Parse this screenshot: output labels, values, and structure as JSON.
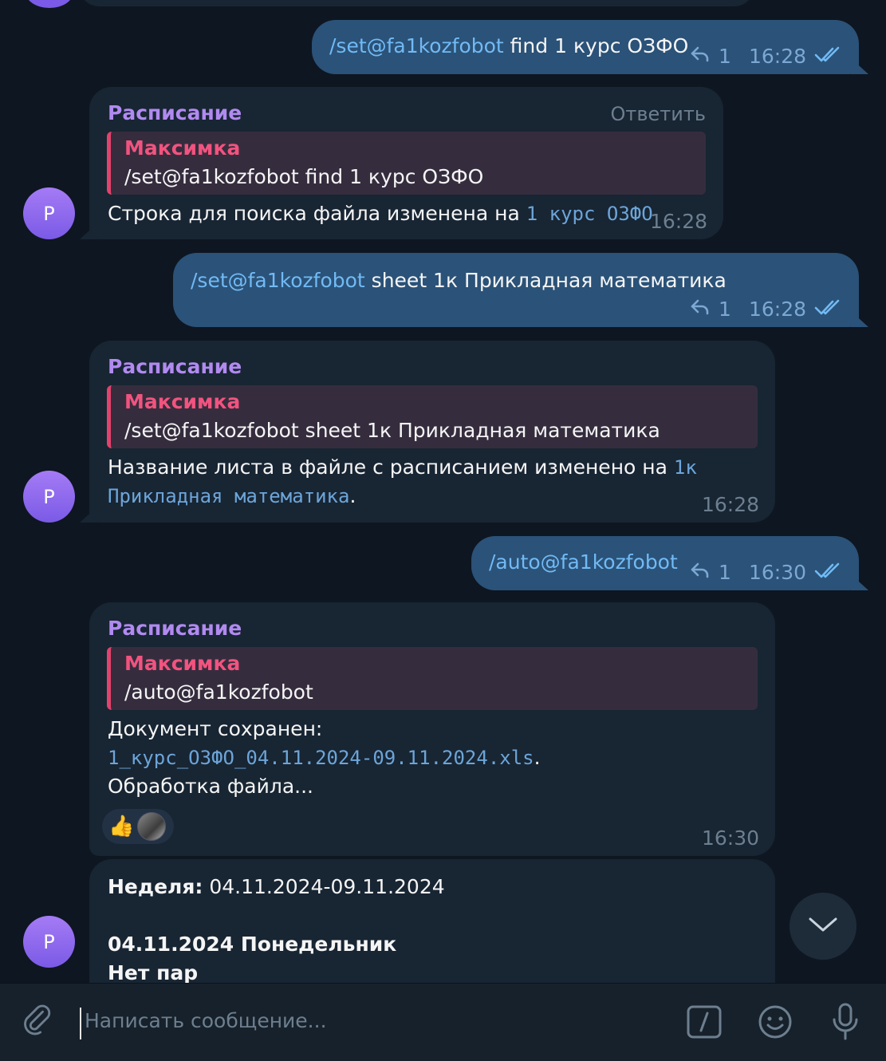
{
  "messages": {
    "out1": {
      "cmd": "/set@fa1kozfobot",
      "rest": " find 1 курс ОЗФО",
      "replies": "1",
      "time": "16:28"
    },
    "in1": {
      "sender": "Расписание",
      "reply_action": "Ответить",
      "quote_name": "Максимка",
      "quote_text": "/set@fa1kozfobot find 1 курс ОЗФО",
      "text": "Строка для поиска файла изменена на ",
      "code": "1 курс ОЗФО",
      "time": "16:28"
    },
    "out2": {
      "cmd": "/set@fa1kozfobot",
      "rest": " sheet 1к Прикладная математика",
      "replies": "1",
      "time": "16:28"
    },
    "in2": {
      "sender": "Расписание",
      "quote_name": "Максимка",
      "quote_text": "/set@fa1kozfobot sheet 1к Прикладная математика",
      "text": "Название листа в файле с расписанием изменено на ",
      "code1": "1к",
      "code2": "Прикладная математика",
      "tail": ".",
      "time": "16:28"
    },
    "out3": {
      "cmd": "/auto@fa1kozfobot",
      "replies": "1",
      "time": "16:30"
    },
    "in3": {
      "sender": "Расписание",
      "quote_name": "Максимка",
      "quote_text": "/auto@fa1kozfobot",
      "line1": "Документ сохранен:",
      "file": "1_курс_ОЗФО_04.11.2024-09.11.2024.xls",
      "file_tail": ".",
      "line3": "Обработка файла...",
      "reaction_emoji": "👍",
      "time": "16:30"
    },
    "in4": {
      "week_label": "Неделя:",
      "week_value": " 04.11.2024-09.11.2024",
      "day": "04.11.2024 Понедельник",
      "no_lessons": "Нет пар"
    }
  },
  "avatar_letter": "P",
  "composer": {
    "placeholder": "Написать сообщение..."
  },
  "icons": {
    "attach": "paperclip-icon",
    "commands": "slash-command-icon",
    "emoji": "smile-icon",
    "voice": "microphone-icon",
    "scroll": "chevron-down-icon",
    "reply": "reply-arrow-icon",
    "read": "double-check-icon"
  },
  "colors": {
    "background": "#0e1621",
    "outgoing": "#2b5278",
    "incoming": "#182533",
    "sender": "#b18af0",
    "quote_name": "#f2537f",
    "link": "#71baf5"
  }
}
